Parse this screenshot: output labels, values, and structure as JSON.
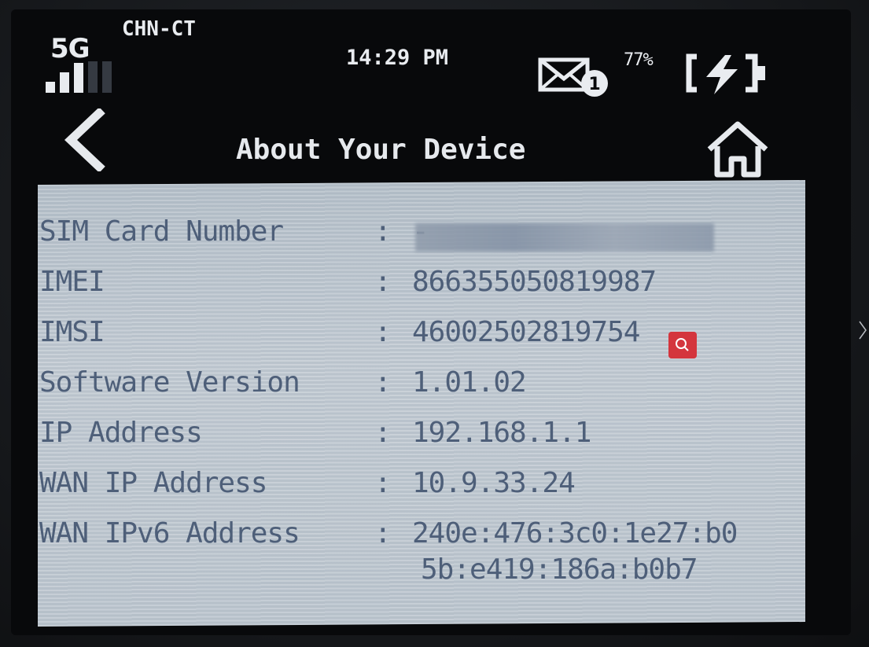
{
  "status_bar": {
    "network_type": "5G",
    "carrier": "CHN-CT",
    "time": "14:29 PM",
    "unread_messages": "1",
    "battery_percent": "77%"
  },
  "header": {
    "title": "About Your Device"
  },
  "separator": ":",
  "info": {
    "sim_card_number": {
      "label": "SIM Card Number",
      "value": "-"
    },
    "imei": {
      "label": "IMEI",
      "value": "866355050819987"
    },
    "imsi": {
      "label": "IMSI",
      "value": "46002502819754"
    },
    "software_version": {
      "label": "Software Version",
      "value": "1.01.02"
    },
    "ip_address": {
      "label": "IP Address",
      "value": "192.168.1.1"
    },
    "wan_ip_address": {
      "label": "WAN IP Address",
      "value": "10.9.33.24"
    },
    "wan_ipv6_address": {
      "label": "WAN IPv6 Address",
      "value_line1": "240e:476:3c0:1e27:b0",
      "value_line2": "5b:e419:186a:b0b7"
    }
  },
  "colors": {
    "panel": "#c0c9d1",
    "text": "#4e5f79",
    "screen": "#08090b",
    "badge": "#d4353d"
  },
  "icons": {
    "back": "chevron-left-icon",
    "home": "home-icon",
    "mail": "mail-icon",
    "battery": "battery-charging-icon",
    "signal": "signal-bars-icon",
    "search": "magnifier-icon",
    "next": "chevron-right-icon"
  }
}
